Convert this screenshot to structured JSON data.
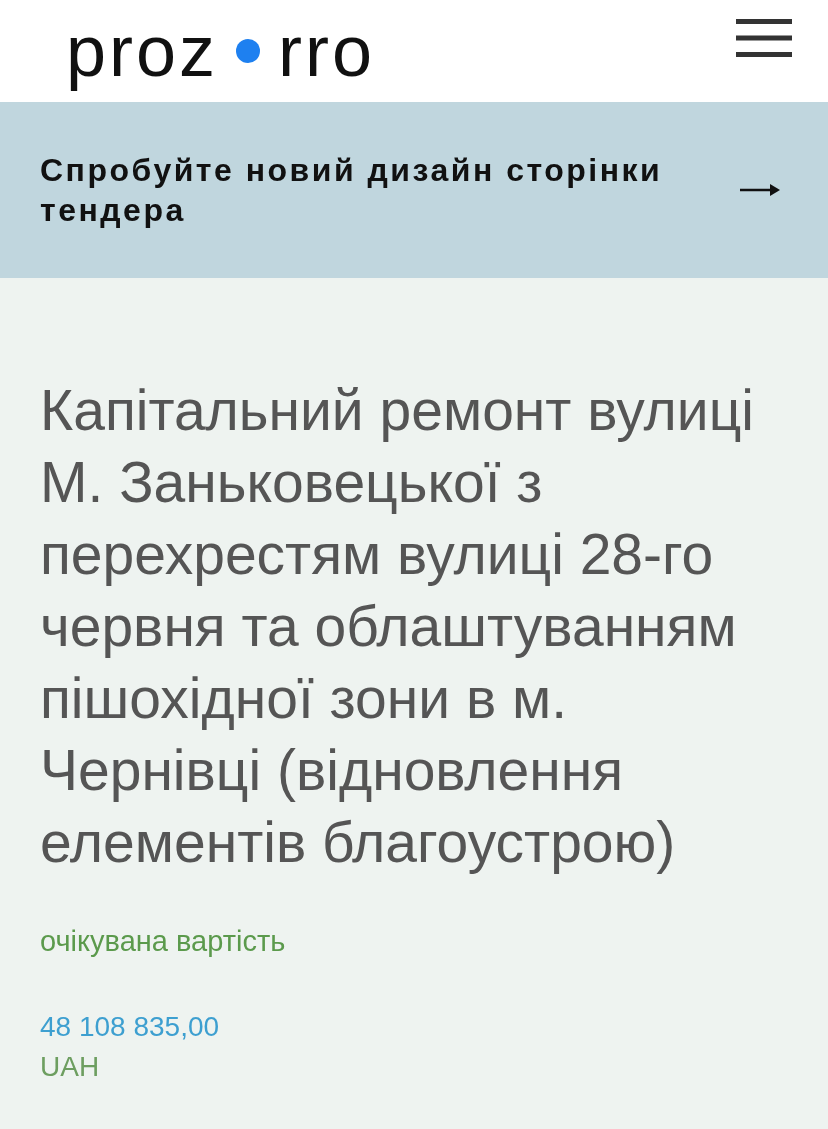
{
  "header": {
    "logo": {
      "before_dot": "proz",
      "after_dot": "rro"
    }
  },
  "banner": {
    "text": "Спробуйте новий дизайн сторінки тендера"
  },
  "tender": {
    "title": "Капітальний ремонт вулиці М. Заньковецької з перехрестям вулиці 28-го червня та облаштуванням пішохідної зони в м. Чернівці (відновлення елементів благоустрою)",
    "value_label": "очікувана вартість",
    "amount": "48 108 835,00",
    "currency": "UAH"
  }
}
